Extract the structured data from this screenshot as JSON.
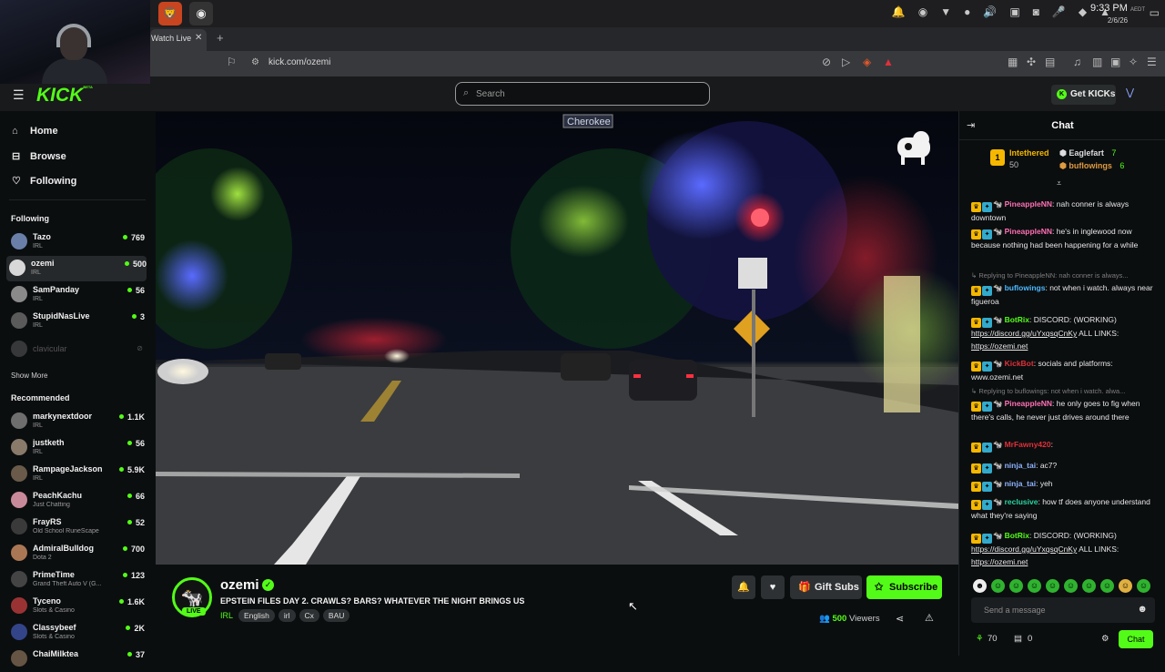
{
  "system": {
    "time": "9:33 PM",
    "timezone": "AEDT",
    "date": "2/6/26"
  },
  "browser": {
    "tab_title": "Watch Live",
    "url": "kick.com/ozemi"
  },
  "header": {
    "logo": "KICK",
    "logo_badge": "BETA",
    "search_placeholder": "Search",
    "get_kicks": "Get KICKs"
  },
  "sidebar": {
    "nav": [
      {
        "label": "Home",
        "icon": "home-icon"
      },
      {
        "label": "Browse",
        "icon": "browse-icon"
      },
      {
        "label": "Following",
        "icon": "heart-icon"
      }
    ],
    "following_title": "Following",
    "following": [
      {
        "name": "Tazo",
        "category": "IRL",
        "viewers": "769",
        "color": "#6a7fa8"
      },
      {
        "name": "ozemi",
        "category": "IRL",
        "viewers": "500",
        "color": "#d8d8d8"
      },
      {
        "name": "SamPanday",
        "category": "IRL",
        "viewers": "56",
        "color": "#8a8a8a"
      },
      {
        "name": "StupidNasLive",
        "category": "IRL",
        "viewers": "3",
        "color": "#5a5a5a"
      },
      {
        "name": "clavicular",
        "category": "",
        "viewers": "",
        "color": "#777"
      }
    ],
    "show_more": "Show More",
    "recommended_title": "Recommended",
    "recommended": [
      {
        "name": "markynextdoor",
        "category": "IRL",
        "viewers": "1.1K",
        "color": "#6e6e6e"
      },
      {
        "name": "justketh",
        "category": "IRL",
        "viewers": "56",
        "color": "#8a7a6a"
      },
      {
        "name": "RampageJackson",
        "category": "IRL",
        "viewers": "5.9K",
        "color": "#6a5a4a"
      },
      {
        "name": "PeachKachu",
        "category": "Just Chatting",
        "viewers": "66",
        "color": "#c88a9a"
      },
      {
        "name": "FrayRS",
        "category": "Old School RuneScape",
        "viewers": "52",
        "color": "#3a3a3a"
      },
      {
        "name": "AdmiralBulldog",
        "category": "Dota 2",
        "viewers": "700",
        "color": "#aa7755"
      },
      {
        "name": "PrimeTime",
        "category": "Grand Theft Auto V (G...",
        "viewers": "123",
        "color": "#444"
      },
      {
        "name": "Tyceno",
        "category": "Slots & Casino",
        "viewers": "1.6K",
        "color": "#993333"
      },
      {
        "name": "Classybeef",
        "category": "Slots & Casino",
        "viewers": "2K",
        "color": "#334488"
      },
      {
        "name": "ChaiMilktea",
        "category": "",
        "viewers": "37",
        "color": "#665544"
      }
    ]
  },
  "video": {
    "street_sign": "Cherokee"
  },
  "stream": {
    "channel": "ozemi",
    "title": "EPSTEIN FILES DAY 2. CRAWLS? BARS? WHATEVER THE NIGHT BRINGS US",
    "live": "LIVE",
    "category": "IRL",
    "tags": [
      "English",
      "irl",
      "Cx",
      "BAU"
    ],
    "gift_subs": "Gift Subs",
    "subscribe": "Subscribe",
    "viewers_count": "500",
    "viewers_label": "Viewers"
  },
  "chat": {
    "title": "Chat",
    "leaderboard": {
      "first_name": "Intethered",
      "first_value": "50",
      "second_name": "Eaglefart",
      "second_value": "7",
      "third_name": "buflowings",
      "third_value": "6"
    },
    "messages": [
      {
        "user": "PineappleNN",
        "color": "#ff6fb5",
        "text": "nah conner is always downtown"
      },
      {
        "user": "PineappleNN",
        "color": "#ff6fb5",
        "text": "he's in inglewood now because nothing had been happening for a while"
      },
      {
        "reply": "Replying to PineappleNN: nah conner is always..."
      },
      {
        "user": "buflowings",
        "color": "#4db8ff",
        "text": "not when i watch. always near figueroa"
      },
      {
        "user": "BotRix",
        "color": "#53fc18",
        "text": "DISCORD: (WORKING)",
        "link1": "https://discord.gg/uYxqsqCnKy",
        "mid": "ALL LINKS:",
        "link2": "https://ozemi.net"
      },
      {
        "user": "KickBot",
        "color": "#e0303a",
        "text": "socials and platforms: www.ozemi.net"
      },
      {
        "reply": "Replying to buflowings: not when i watch. alwa..."
      },
      {
        "user": "PineappleNN",
        "color": "#ff6fb5",
        "text": "he only goes to fig when there's calls, he never just drives around there"
      },
      {
        "user": "MrFawny420",
        "color": "#e0303a",
        "text": ""
      },
      {
        "user": "ninja_tai",
        "color": "#8fb4ff",
        "text": "ac7?"
      },
      {
        "user": "ninja_tai",
        "color": "#8fb4ff",
        "text": "yeh"
      },
      {
        "user": "reclusive",
        "color": "#2ad4a0",
        "text": "how tf does anyone understand what they're saying"
      },
      {
        "user": "BotRix",
        "color": "#53fc18",
        "text": "DISCORD: (WORKING)",
        "link1": "https://discord.gg/uYxqsqCnKy",
        "mid": "ALL LINKS:",
        "link2": "https://ozemi.net"
      }
    ],
    "input_placeholder": "Send a message",
    "points": "70",
    "wallet": "0",
    "chat_button": "Chat"
  },
  "colors": {
    "accent": "#53fc18",
    "bg": "#0b0e0f"
  }
}
